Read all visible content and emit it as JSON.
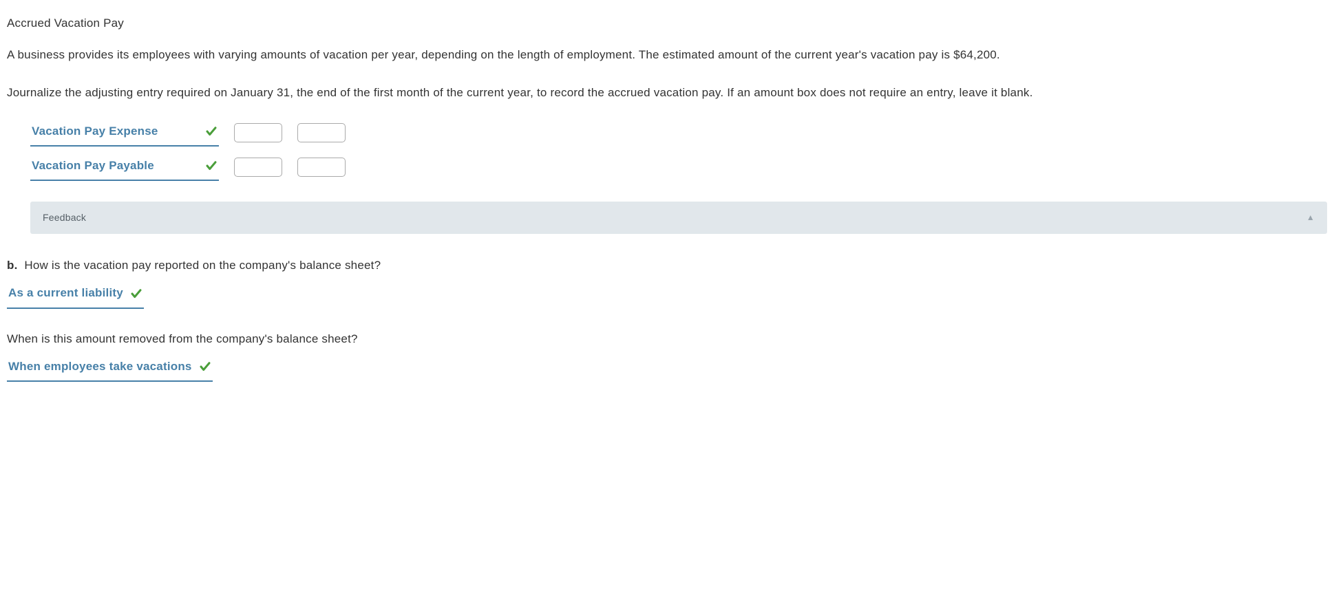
{
  "title": "Accrued Vacation Pay",
  "para1": "A business provides its employees with varying amounts of vacation per year, depending on the length of employment. The estimated amount of the current year's vacation pay is $64,200.",
  "para2": "Journalize the adjusting entry required on January 31, the end of the first month of the current year, to record the accrued vacation pay. If an amount box does not require an entry, leave it blank.",
  "journal": {
    "rows": [
      {
        "account": "Vacation Pay Expense",
        "debit": "",
        "credit": ""
      },
      {
        "account": "Vacation Pay Payable",
        "debit": "",
        "credit": ""
      }
    ]
  },
  "feedback_label": "Feedback",
  "partB": {
    "label": "b.",
    "question1": "How is the vacation pay reported on the company's balance sheet?",
    "answer1": "As a current liability",
    "question2": "When is this amount removed from the company's balance sheet?",
    "answer2": "When employees take vacations"
  }
}
